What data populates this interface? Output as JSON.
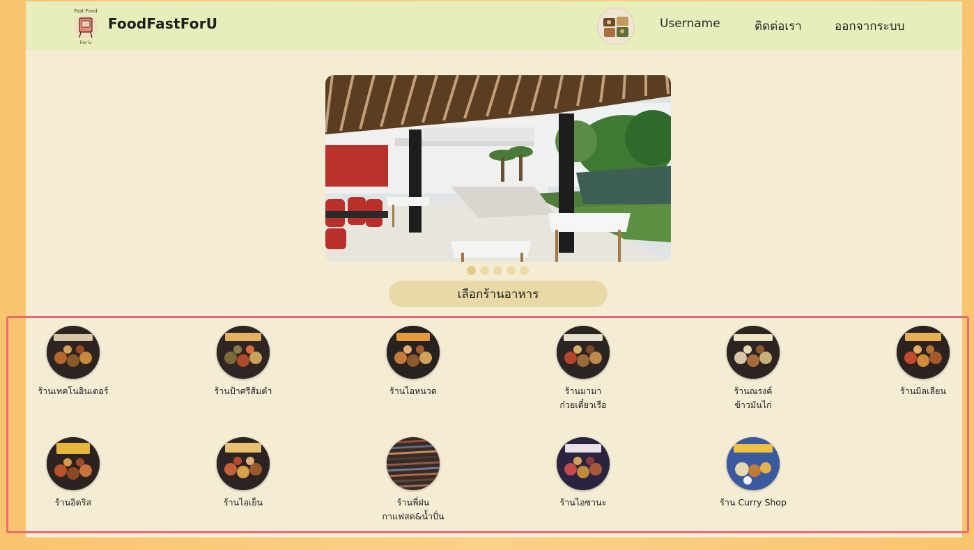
{
  "header": {
    "logo_text_top": "Fast Food",
    "logo_text_bottom": "For U",
    "brand": "FoodFastForU",
    "username": "Username",
    "contact": "ติดต่อเรา",
    "logout": "ออกจากระบบ"
  },
  "carousel": {
    "slides": 5,
    "active": 1
  },
  "choose_button": "เลือกร้านอาหาร",
  "shops": [
    {
      "name": "ร้านเทคโนอินเตอร์",
      "thumb": "restaurant-menu-board"
    },
    {
      "name": "ร้านป้าศรีส้มตำ",
      "thumb": "restaurant-menu-board"
    },
    {
      "name": "ร้านไอหนวด",
      "thumb": "restaurant-menu-board"
    },
    {
      "name": "ร้านมามา\nก๋วยเตี๋ยวเรือ",
      "thumb": "restaurant-menu-board"
    },
    {
      "name": "ร้านณรงค์\nข้าวมันไก่",
      "thumb": "restaurant-menu-board"
    },
    {
      "name": "ร้านมิลเลียน",
      "thumb": "restaurant-menu-board"
    },
    {
      "name": "ร้านอิดริส",
      "thumb": "restaurant-menu-board"
    },
    {
      "name": "ร้านไอเย็น",
      "thumb": "restaurant-menu-board"
    },
    {
      "name": "ร้านพี่ฝน\nกาแฟสด&น้ำปั่น",
      "thumb": "striped-menu"
    },
    {
      "name": "ร้านไอซานะ",
      "thumb": "restaurant-menu-board"
    },
    {
      "name": "ร้าน Curry Shop",
      "thumb": "curry-menu"
    }
  ],
  "colors": {
    "navbar": "#e7eebb",
    "page": "#f5ecd4",
    "outer": "#f9c46e",
    "button": "#e8d9a6",
    "highlight_border": "#e86a6f"
  }
}
